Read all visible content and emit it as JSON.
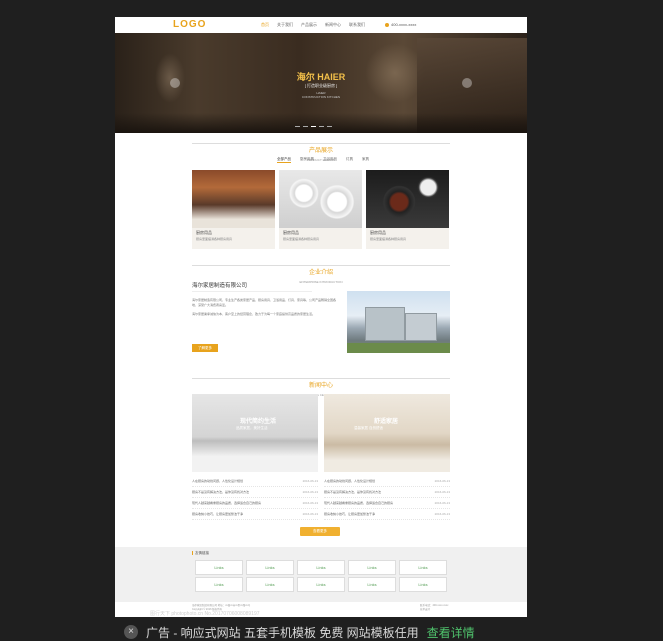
{
  "header": {
    "logo": "LOGO",
    "nav": [
      "首页",
      "关于我们",
      "产品展示",
      "新闻中心",
      "联系我们"
    ],
    "phone": "400-xxxx-xxxx"
  },
  "hero": {
    "title": "海尔 HAIER",
    "subtitle": "[ 打造职业级厨房 ]",
    "small1": "HAIER",
    "small2": "CONSTRUCTION KITCHEN"
  },
  "products": {
    "title": "产品展示",
    "title_en": "PRODUCT DISPLAY",
    "tabs": [
      "全部产品",
      "厨房用具",
      "卫浴用品",
      "灯具",
      "家具"
    ],
    "cards": [
      {
        "title": "厨房用品",
        "desc": "厨房里面摆满各种厨房用具"
      },
      {
        "title": "厨房用品",
        "desc": "厨房里面摆满各种厨房用具"
      },
      {
        "title": "厨房用品",
        "desc": "厨房里面摆满各种厨房用具"
      }
    ]
  },
  "about": {
    "title": "企业介绍",
    "title_en": "ENTERPRISE INTRODUCTION",
    "company": "海尔家居制造有限公司",
    "para1": "海尔家居制造有限公司，专业生产各类家居产品，厨房用具、卫浴用品、灯具、家具等，公司产品畅销全国各地，深受广大消费者喜爱。",
    "para2": "海尔家居秉承诚信为本、客户至上的经营理念，致力于为每一个家庭提供高品质的家居生活。",
    "button": "了解更多"
  },
  "news": {
    "title": "新闻中心",
    "title_en": "NEWS CENTER",
    "img1_title": "现代简约生活",
    "img1_sub": "品质家居，美好生活",
    "img2_title": "舒适家居",
    "img2_sub": "温馨家居 自然舒适",
    "left": [
      {
        "text": "人在厨房的动线问题，人性化设计规划",
        "date": "2016-06-13"
      },
      {
        "text": "厨房不是没有解决方法，是你没有找对方法",
        "date": "2016-06-13"
      },
      {
        "text": "现代人越来越看重厨房的品质，选择适合自己的厨房",
        "date": "2016-06-13"
      },
      {
        "text": "厨房收纳小技巧，让厨房更加整洁干净",
        "date": "2016-06-13"
      }
    ],
    "right": [
      {
        "text": "人在厨房的动线问题，人性化设计规划",
        "date": "2016-06-13"
      },
      {
        "text": "厨房不是没有解决方法，是你没有找对方法",
        "date": "2016-06-13"
      },
      {
        "text": "现代人越来越看重厨房的品质，选择适合自己的厨房",
        "date": "2016-06-13"
      },
      {
        "text": "厨房收纳小技巧，让厨房更加整洁干净",
        "date": "2016-06-13"
      }
    ],
    "more": "查看更多"
  },
  "links": {
    "title": "友情链接",
    "items": [
      "Links",
      "Links",
      "Links",
      "Links",
      "Links",
      "Links",
      "Links",
      "Links",
      "Links",
      "Links"
    ]
  },
  "footer": {
    "left1": "海尔家居制造有限公司 地址：xx省xx市xx区xx路xx号",
    "left2": "Copyright © 2016 版权所有",
    "right1": "联系电话：400-xxxx-xxxx",
    "right2": "技术支持"
  },
  "watermark": "图行天下 photophoto.cn   No.20170706008089197",
  "ad": {
    "text": "广告 - 响应式网站 五套手机模板 免费 网站模板任用",
    "link": "查看详情"
  },
  "colors": {
    "accent": "#e8a31d",
    "bg": "#1f1f1f",
    "link_green": "#4fc26c"
  }
}
